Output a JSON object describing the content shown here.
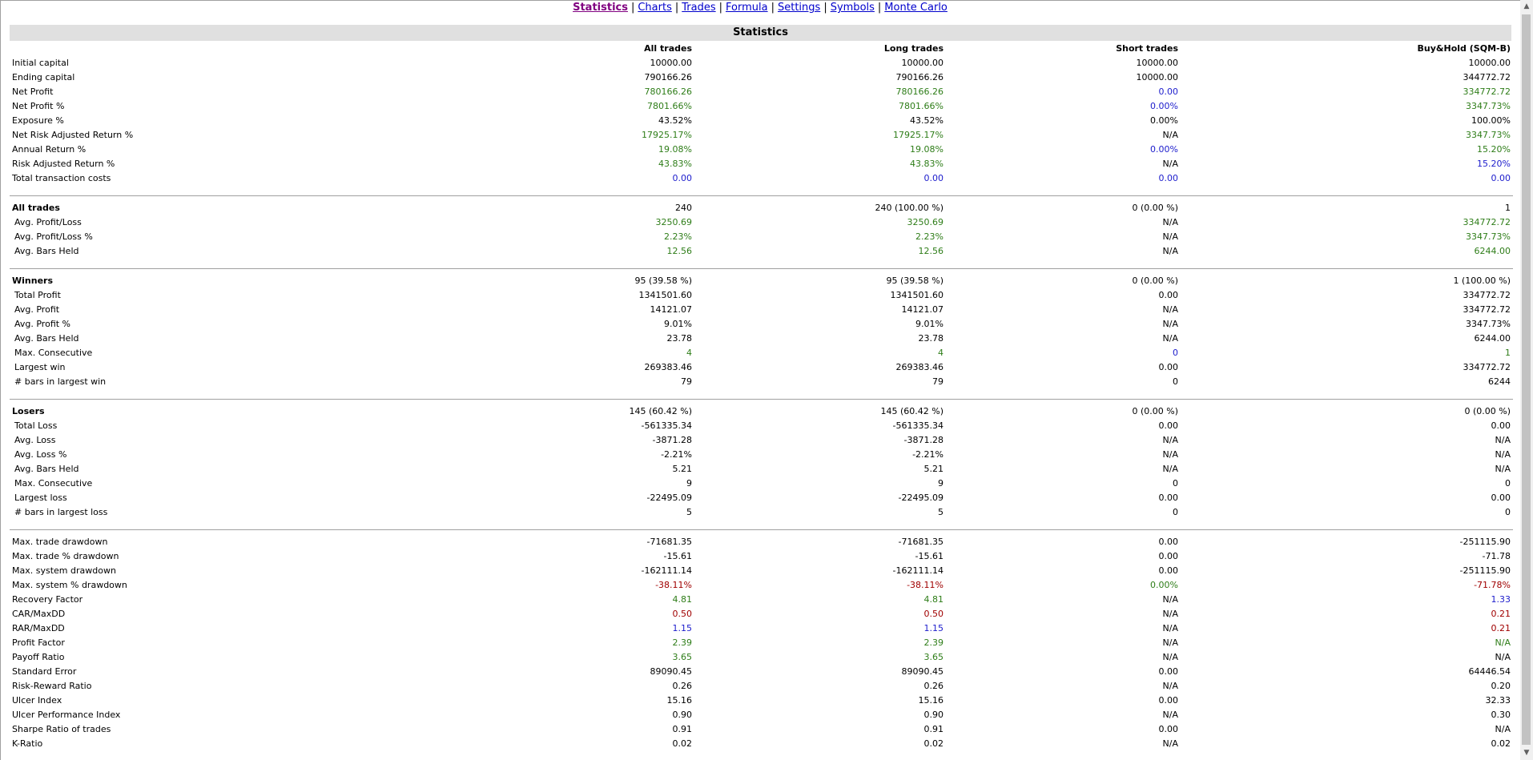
{
  "nav": {
    "items": [
      "Statistics",
      "Charts",
      "Trades",
      "Formula",
      "Settings",
      "Symbols",
      "Monte Carlo"
    ],
    "active": "Statistics",
    "separator": "|"
  },
  "title": "Statistics",
  "columns": [
    "All trades",
    "Long trades",
    "Short trades",
    "Buy&Hold (SQM-B)"
  ],
  "colors": {
    "green": "#2e7d18",
    "blue": "#1c1ccc",
    "red": "#a00000",
    "black": "#000000"
  },
  "sections": [
    {
      "header": null,
      "rows": [
        {
          "label": "Initial capital",
          "values": [
            "10000.00",
            "10000.00",
            "10000.00",
            "10000.00"
          ],
          "colors": [
            "k",
            "k",
            "k",
            "k"
          ]
        },
        {
          "label": "Ending capital",
          "values": [
            "790166.26",
            "790166.26",
            "10000.00",
            "344772.72"
          ],
          "colors": [
            "k",
            "k",
            "k",
            "k"
          ]
        },
        {
          "label": "Net Profit",
          "values": [
            "780166.26",
            "780166.26",
            "0.00",
            "334772.72"
          ],
          "colors": [
            "g",
            "g",
            "b",
            "g"
          ]
        },
        {
          "label": "Net Profit %",
          "values": [
            "7801.66%",
            "7801.66%",
            "0.00%",
            "3347.73%"
          ],
          "colors": [
            "g",
            "g",
            "b",
            "g"
          ]
        },
        {
          "label": "Exposure %",
          "values": [
            "43.52%",
            "43.52%",
            "0.00%",
            "100.00%"
          ],
          "colors": [
            "k",
            "k",
            "k",
            "k"
          ]
        },
        {
          "label": "Net Risk Adjusted Return %",
          "values": [
            "17925.17%",
            "17925.17%",
            "N/A",
            "3347.73%"
          ],
          "colors": [
            "g",
            "g",
            "k",
            "g"
          ]
        },
        {
          "label": "Annual Return %",
          "values": [
            "19.08%",
            "19.08%",
            "0.00%",
            "15.20%"
          ],
          "colors": [
            "g",
            "g",
            "b",
            "g"
          ]
        },
        {
          "label": "Risk Adjusted Return %",
          "values": [
            "43.83%",
            "43.83%",
            "N/A",
            "15.20%"
          ],
          "colors": [
            "g",
            "g",
            "k",
            "b"
          ]
        },
        {
          "label": "Total transaction costs",
          "values": [
            "0.00",
            "0.00",
            "0.00",
            "0.00"
          ],
          "colors": [
            "b",
            "b",
            "b",
            "b"
          ]
        }
      ]
    },
    {
      "header": {
        "label": "All trades",
        "values": [
          "240",
          "240 (100.00 %)",
          "0 (0.00 %)",
          "1"
        ]
      },
      "rows": [
        {
          "label": "Avg. Profit/Loss",
          "values": [
            "3250.69",
            "3250.69",
            "N/A",
            "334772.72"
          ],
          "colors": [
            "g",
            "g",
            "k",
            "g"
          ]
        },
        {
          "label": "Avg. Profit/Loss %",
          "values": [
            "2.23%",
            "2.23%",
            "N/A",
            "3347.73%"
          ],
          "colors": [
            "g",
            "g",
            "k",
            "g"
          ]
        },
        {
          "label": "Avg. Bars Held",
          "values": [
            "12.56",
            "12.56",
            "N/A",
            "6244.00"
          ],
          "colors": [
            "g",
            "g",
            "k",
            "g"
          ]
        }
      ]
    },
    {
      "header": {
        "label": "Winners",
        "values": [
          "95 (39.58 %)",
          "95 (39.58 %)",
          "0 (0.00 %)",
          "1 (100.00 %)"
        ]
      },
      "rows": [
        {
          "label": "Total Profit",
          "values": [
            "1341501.60",
            "1341501.60",
            "0.00",
            "334772.72"
          ],
          "colors": [
            "k",
            "k",
            "k",
            "k"
          ]
        },
        {
          "label": "Avg. Profit",
          "values": [
            "14121.07",
            "14121.07",
            "N/A",
            "334772.72"
          ],
          "colors": [
            "k",
            "k",
            "k",
            "k"
          ]
        },
        {
          "label": "Avg. Profit %",
          "values": [
            "9.01%",
            "9.01%",
            "N/A",
            "3347.73%"
          ],
          "colors": [
            "k",
            "k",
            "k",
            "k"
          ]
        },
        {
          "label": "Avg. Bars Held",
          "values": [
            "23.78",
            "23.78",
            "N/A",
            "6244.00"
          ],
          "colors": [
            "k",
            "k",
            "k",
            "k"
          ]
        },
        {
          "label": "Max. Consecutive",
          "values": [
            "4",
            "4",
            "0",
            "1"
          ],
          "colors": [
            "g",
            "g",
            "b",
            "g"
          ]
        },
        {
          "label": "Largest win",
          "values": [
            "269383.46",
            "269383.46",
            "0.00",
            "334772.72"
          ],
          "colors": [
            "k",
            "k",
            "k",
            "k"
          ]
        },
        {
          "label": "# bars in largest win",
          "values": [
            "79",
            "79",
            "0",
            "6244"
          ],
          "colors": [
            "k",
            "k",
            "k",
            "k"
          ]
        }
      ]
    },
    {
      "header": {
        "label": "Losers",
        "values": [
          "145 (60.42 %)",
          "145 (60.42 %)",
          "0 (0.00 %)",
          "0 (0.00 %)"
        ]
      },
      "rows": [
        {
          "label": "Total Loss",
          "values": [
            "-561335.34",
            "-561335.34",
            "0.00",
            "0.00"
          ],
          "colors": [
            "k",
            "k",
            "k",
            "k"
          ]
        },
        {
          "label": "Avg. Loss",
          "values": [
            "-3871.28",
            "-3871.28",
            "N/A",
            "N/A"
          ],
          "colors": [
            "k",
            "k",
            "k",
            "k"
          ]
        },
        {
          "label": "Avg. Loss %",
          "values": [
            "-2.21%",
            "-2.21%",
            "N/A",
            "N/A"
          ],
          "colors": [
            "k",
            "k",
            "k",
            "k"
          ]
        },
        {
          "label": "Avg. Bars Held",
          "values": [
            "5.21",
            "5.21",
            "N/A",
            "N/A"
          ],
          "colors": [
            "k",
            "k",
            "k",
            "k"
          ]
        },
        {
          "label": "Max. Consecutive",
          "values": [
            "9",
            "9",
            "0",
            "0"
          ],
          "colors": [
            "k",
            "k",
            "k",
            "k"
          ]
        },
        {
          "label": "Largest loss",
          "values": [
            "-22495.09",
            "-22495.09",
            "0.00",
            "0.00"
          ],
          "colors": [
            "k",
            "k",
            "k",
            "k"
          ]
        },
        {
          "label": "# bars in largest loss",
          "values": [
            "5",
            "5",
            "0",
            "0"
          ],
          "colors": [
            "k",
            "k",
            "k",
            "k"
          ]
        }
      ]
    },
    {
      "header": null,
      "rows": [
        {
          "label": "Max. trade drawdown",
          "values": [
            "-71681.35",
            "-71681.35",
            "0.00",
            "-251115.90"
          ],
          "colors": [
            "k",
            "k",
            "k",
            "k"
          ]
        },
        {
          "label": "Max. trade % drawdown",
          "values": [
            "-15.61",
            "-15.61",
            "0.00",
            "-71.78"
          ],
          "colors": [
            "k",
            "k",
            "k",
            "k"
          ]
        },
        {
          "label": "Max. system drawdown",
          "values": [
            "-162111.14",
            "-162111.14",
            "0.00",
            "-251115.90"
          ],
          "colors": [
            "k",
            "k",
            "k",
            "k"
          ]
        },
        {
          "label": "Max. system % drawdown",
          "values": [
            "-38.11%",
            "-38.11%",
            "0.00%",
            "-71.78%"
          ],
          "colors": [
            "r",
            "r",
            "g",
            "r"
          ]
        },
        {
          "label": "Recovery Factor",
          "values": [
            "4.81",
            "4.81",
            "N/A",
            "1.33"
          ],
          "colors": [
            "g",
            "g",
            "k",
            "b"
          ]
        },
        {
          "label": "CAR/MaxDD",
          "values": [
            "0.50",
            "0.50",
            "N/A",
            "0.21"
          ],
          "colors": [
            "r",
            "r",
            "k",
            "r"
          ]
        },
        {
          "label": "RAR/MaxDD",
          "values": [
            "1.15",
            "1.15",
            "N/A",
            "0.21"
          ],
          "colors": [
            "b",
            "b",
            "k",
            "r"
          ]
        },
        {
          "label": "Profit Factor",
          "values": [
            "2.39",
            "2.39",
            "N/A",
            "N/A"
          ],
          "colors": [
            "g",
            "g",
            "k",
            "g"
          ]
        },
        {
          "label": "Payoff Ratio",
          "values": [
            "3.65",
            "3.65",
            "N/A",
            "N/A"
          ],
          "colors": [
            "g",
            "g",
            "k",
            "k"
          ]
        },
        {
          "label": "Standard Error",
          "values": [
            "89090.45",
            "89090.45",
            "0.00",
            "64446.54"
          ],
          "colors": [
            "k",
            "k",
            "k",
            "k"
          ]
        },
        {
          "label": "Risk-Reward Ratio",
          "values": [
            "0.26",
            "0.26",
            "N/A",
            "0.20"
          ],
          "colors": [
            "k",
            "k",
            "k",
            "k"
          ]
        },
        {
          "label": "Ulcer Index",
          "values": [
            "15.16",
            "15.16",
            "0.00",
            "32.33"
          ],
          "colors": [
            "k",
            "k",
            "k",
            "k"
          ]
        },
        {
          "label": "Ulcer Performance Index",
          "values": [
            "0.90",
            "0.90",
            "N/A",
            "0.30"
          ],
          "colors": [
            "k",
            "k",
            "k",
            "k"
          ]
        },
        {
          "label": "Sharpe Ratio of trades",
          "values": [
            "0.91",
            "0.91",
            "0.00",
            "N/A"
          ],
          "colors": [
            "k",
            "k",
            "k",
            "k"
          ]
        },
        {
          "label": "K-Ratio",
          "values": [
            "0.02",
            "0.02",
            "N/A",
            "0.02"
          ],
          "colors": [
            "k",
            "k",
            "k",
            "k"
          ]
        }
      ]
    }
  ]
}
